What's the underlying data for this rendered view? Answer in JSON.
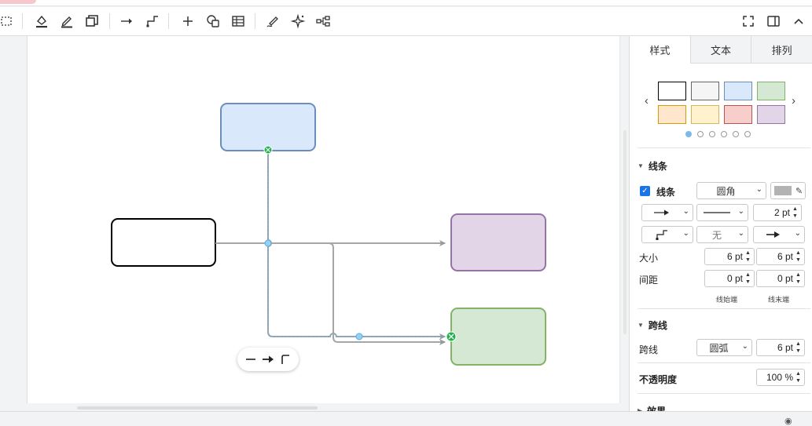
{
  "toolbar": {
    "icons": [
      "select-icon",
      "fill-color-icon",
      "line-color-icon",
      "shadow-icon",
      "connection-icon",
      "waypoints-icon",
      "insert-icon",
      "shapes-icon",
      "table-icon",
      "freehand-icon",
      "ai-sparkle-icon",
      "layout-icon",
      "fullscreen-icon",
      "format-panel-icon",
      "collapse-icon"
    ]
  },
  "panel": {
    "tabs": [
      {
        "label": "样式"
      },
      {
        "label": "文本"
      },
      {
        "label": "排列"
      }
    ],
    "swatch_colors": [
      "#ffffff",
      "#f5f5f5",
      "#dae8fc",
      "#d5e8d4",
      "#ffe6cc",
      "#fff2cc",
      "#f8cecc",
      "#e1d5e7"
    ],
    "swatch_borders": [
      "#000000",
      "#666666",
      "#6c8ebf",
      "#82b366",
      "#d79b00",
      "#d6b656",
      "#b85450",
      "#9673a6"
    ],
    "line_section": {
      "title": "线条",
      "checkbox_label": "线条",
      "corner_select": "圆角",
      "width_value": "2 pt",
      "waypoint_value": "无",
      "size_label": "大小",
      "size_start": "6 pt",
      "size_end": "6 pt",
      "spacing_label": "间距",
      "spacing_start": "0 pt",
      "spacing_end": "0 pt",
      "start_label": "线始端",
      "end_label": "线末端"
    },
    "jump_section": {
      "title": "跨线",
      "label": "跨线",
      "style_select": "圆弧",
      "size_value": "6 pt"
    },
    "opacity": {
      "label": "不透明度",
      "value": "100 %"
    },
    "effects": {
      "title": "效果"
    }
  }
}
